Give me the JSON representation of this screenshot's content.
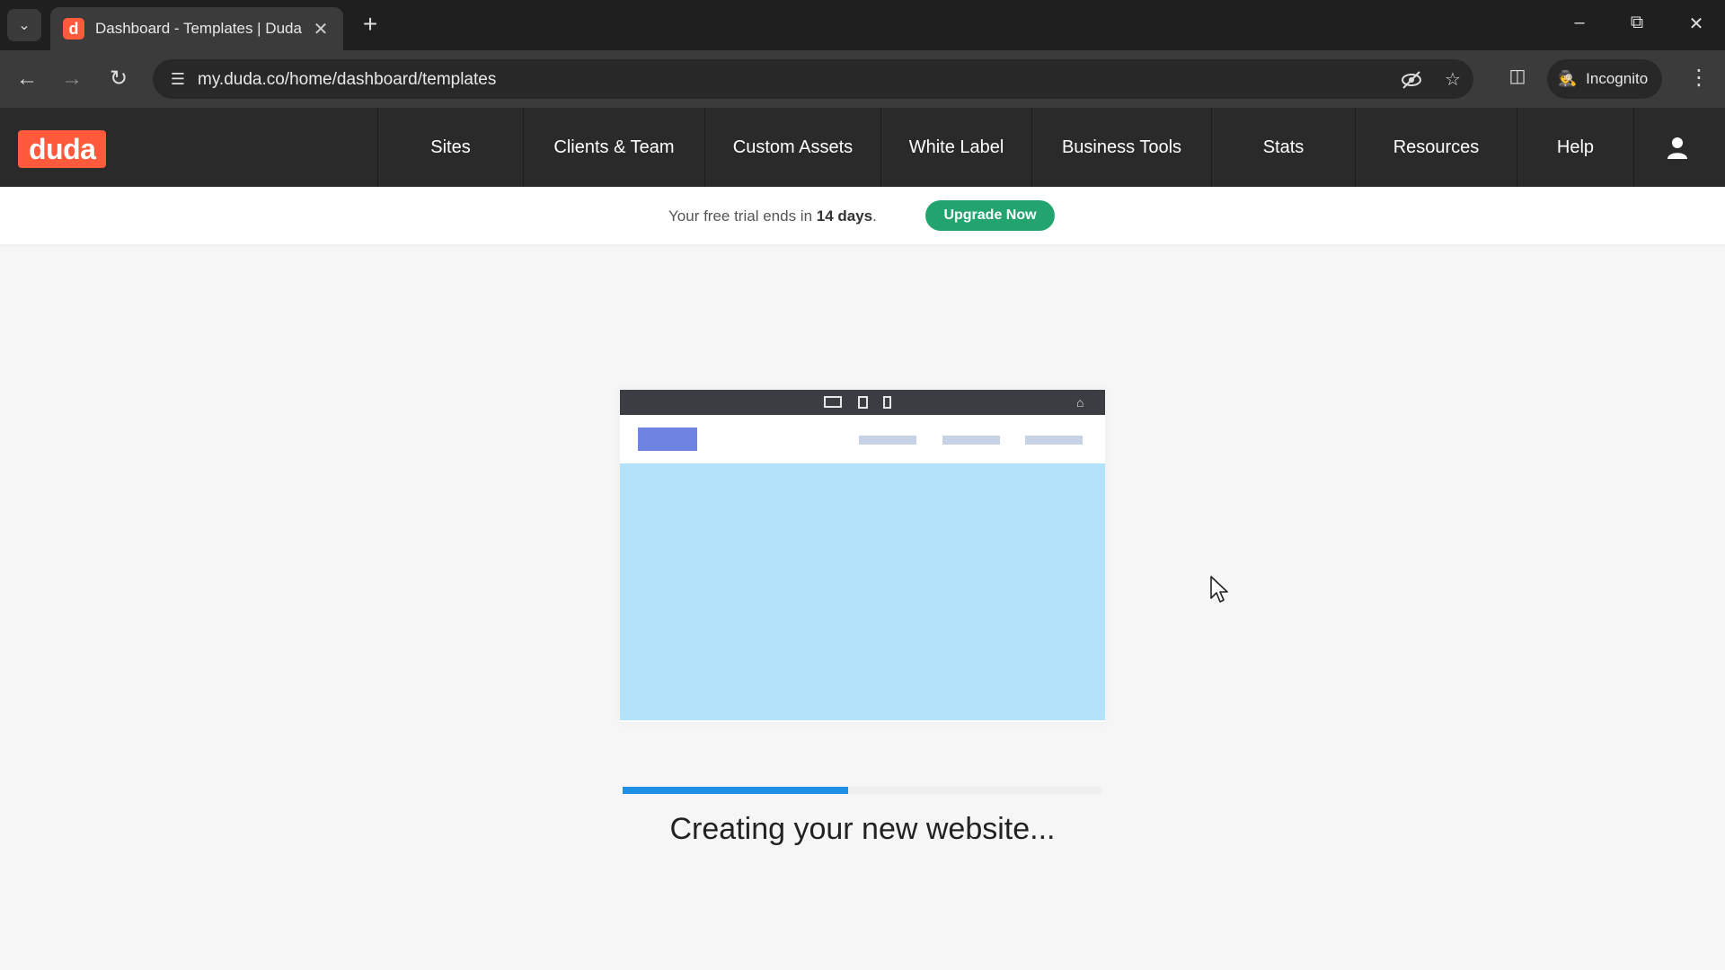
{
  "browser": {
    "tab_title": "Dashboard - Templates | Duda",
    "favicon_letter": "d",
    "url": "my.duda.co/home/dashboard/templates",
    "incognito_label": "Incognito"
  },
  "nav": {
    "logo": "duda",
    "items": [
      "Sites",
      "Clients & Team",
      "Custom Assets",
      "White Label",
      "Business Tools",
      "Stats",
      "Resources",
      "Help"
    ]
  },
  "trial": {
    "text_prefix": "Your free trial ends in ",
    "days": "14 days",
    "text_suffix": ".",
    "upgrade_label": "Upgrade Now"
  },
  "loading": {
    "progress": 0.47,
    "status_text": "Creating your new website..."
  },
  "colors": {
    "brand": "#ff5a3c",
    "upgrade": "#23a46f",
    "progress": "#1f8fe5",
    "hero": "#b3e3fb"
  }
}
